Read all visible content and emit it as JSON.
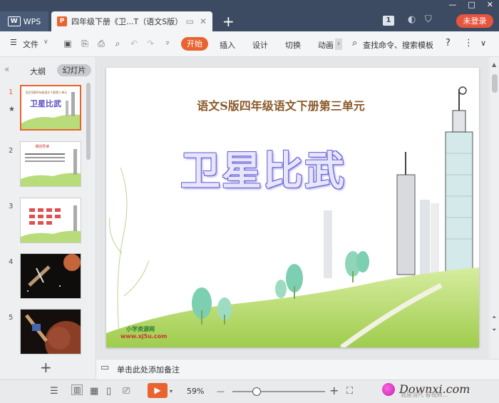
{
  "titlebar": {
    "app_tab": "WPS",
    "doc_tab": "四年级下册《卫...T（语文S版）",
    "new_tab": "+",
    "page_badge": "1",
    "login": "未登录",
    "win_min": "—",
    "win_max": "□",
    "win_close": "✕"
  },
  "toolbar": {
    "file_menu": "文件",
    "tabs": [
      "开始",
      "插入",
      "设计",
      "切换",
      "动画"
    ],
    "search": "查找命令、搜索模板",
    "help": "?",
    "more": "⋮",
    "collapse": "∨"
  },
  "left_panel": {
    "tab_outline": "大纲",
    "tab_slides": "幻灯片",
    "slide_numbers": [
      "1",
      "2",
      "3",
      "4",
      "5"
    ],
    "add_slide": "+"
  },
  "slide": {
    "subtitle": "语文S版四年级语文下册第三单元",
    "title": "卫星比武",
    "logo_line1": "小学资源网",
    "logo_line2": "www.xj5u.com"
  },
  "thumbs": {
    "t1_sub": "语文S版四年级语文下册第三单元",
    "t1_title": "卫星比武",
    "t2_head": "课前导读"
  },
  "notes": {
    "placeholder": "单击此处添加备注"
  },
  "statusbar": {
    "zoom": "59%",
    "zoom_minus": "—",
    "zoom_plus": "+",
    "watermark": "Downxi.com",
    "watermark_sub": "我是当代  看视频..."
  },
  "colors": {
    "accent": "#e8632e",
    "titlebar": "#3d4b62",
    "login": "#e8553f"
  }
}
